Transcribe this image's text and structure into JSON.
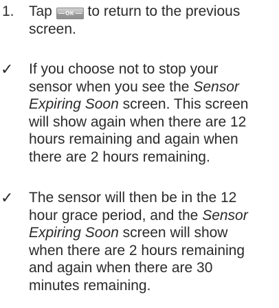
{
  "step": {
    "number": "1.",
    "before": "Tap ",
    "ok_label": "OK",
    "after": " to return to the previous screen."
  },
  "tips": [
    {
      "marker": "✓",
      "part1": "If you choose not to stop your sensor when you see the ",
      "italic": "Sensor Expiring Soon",
      "part2": " screen. This screen will show again when there are 12 hours remaining and again when there are 2 hours remaining."
    },
    {
      "marker": "✓",
      "part1": "The sensor will then be in the 12 hour grace period, and the ",
      "italic": "Sensor Expiring Soon",
      "part2": " screen will show when there are 2 hours remaining and again when there are 30 minutes remaining."
    }
  ]
}
